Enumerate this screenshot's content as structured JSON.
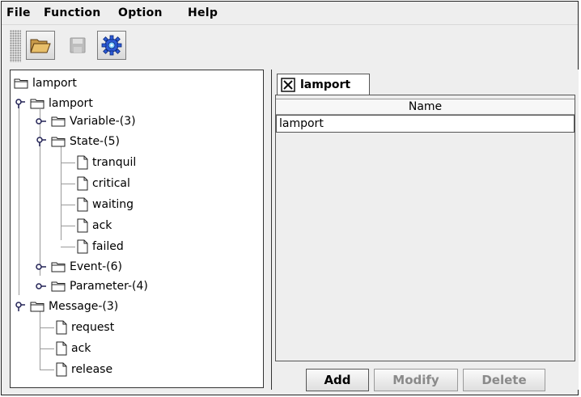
{
  "menu": {
    "items": [
      {
        "label": "File"
      },
      {
        "label": "Function"
      },
      {
        "label": "Option"
      },
      {
        "label": "Help"
      }
    ]
  },
  "toolbar": {
    "buttons": [
      {
        "icon": "folder-open-icon",
        "enabled": true
      },
      {
        "icon": "save-icon",
        "enabled": false
      },
      {
        "icon": "gear-icon",
        "enabled": true
      }
    ]
  },
  "tree": {
    "nodes": [
      {
        "label": "lamport",
        "type": "folder"
      },
      {
        "label": "lamport",
        "type": "folder",
        "expanded": true
      },
      {
        "label": "Variable-(3)",
        "type": "folder",
        "expanded": false
      },
      {
        "label": "State-(5)",
        "type": "folder",
        "expanded": true
      },
      {
        "label": "tranquil",
        "type": "file"
      },
      {
        "label": "critical",
        "type": "file"
      },
      {
        "label": "waiting",
        "type": "file"
      },
      {
        "label": "ack",
        "type": "file"
      },
      {
        "label": "failed",
        "type": "file"
      },
      {
        "label": "Event-(6)",
        "type": "folder",
        "expanded": false
      },
      {
        "label": "Parameter-(4)",
        "type": "folder",
        "expanded": false
      },
      {
        "label": "Message-(3)",
        "type": "folder",
        "expanded": true
      },
      {
        "label": "request",
        "type": "file"
      },
      {
        "label": "ack",
        "type": "file"
      },
      {
        "label": "release",
        "type": "file"
      }
    ]
  },
  "detail": {
    "tab_label": "lamport",
    "table": {
      "headers": [
        "Name"
      ],
      "rows": [
        [
          "lamport"
        ]
      ]
    },
    "buttons": {
      "add": "Add",
      "modify": "Modify",
      "delete": "Delete"
    }
  }
}
